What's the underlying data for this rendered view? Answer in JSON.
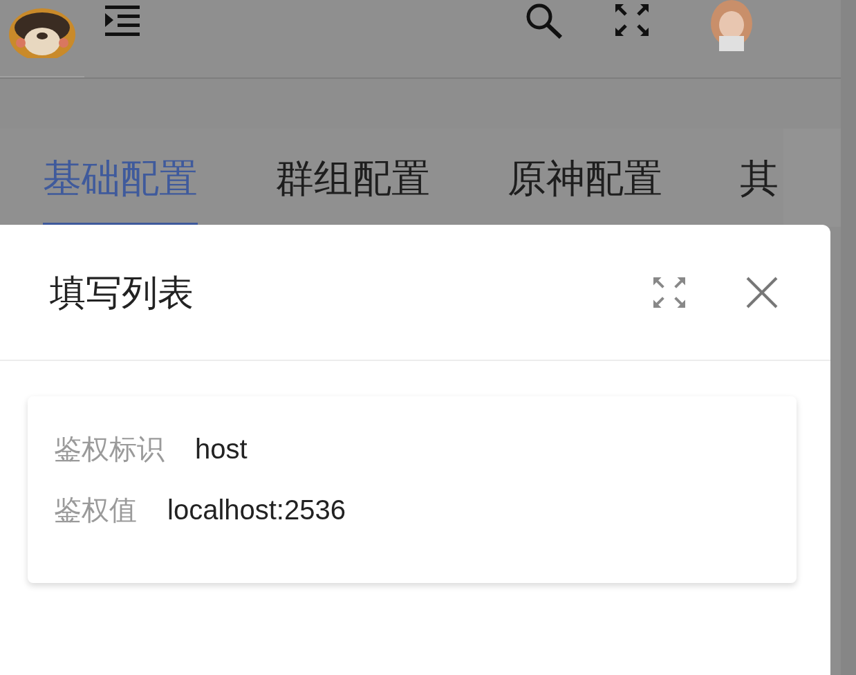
{
  "tabs": [
    {
      "label": "基础配置",
      "selected": true
    },
    {
      "label": "群组配置",
      "selected": false
    },
    {
      "label": "原神配置",
      "selected": false
    },
    {
      "label": "其",
      "selected": false
    }
  ],
  "dialog": {
    "title": "填写列表",
    "fields": [
      {
        "label": "鉴权标识",
        "value": "host"
      },
      {
        "label": "鉴权值",
        "value": "localhost:2536"
      }
    ]
  }
}
